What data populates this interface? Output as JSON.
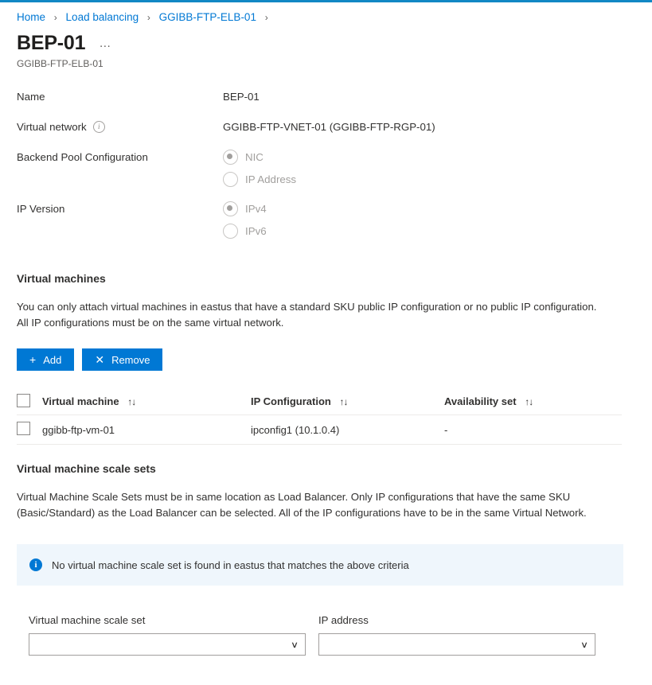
{
  "theme": {
    "accent": "#0078d4",
    "top_bar": "#1288c4",
    "banner_bg": "#eff6fc",
    "link": "#0078d4",
    "text": "#323130",
    "muted": "#605e5c",
    "disabled": "#a19f9d"
  },
  "breadcrumb": {
    "items": [
      "Home",
      "Load balancing",
      "GGIBB-FTP-ELB-01"
    ],
    "separator": "›",
    "trailing_separator": "›"
  },
  "header": {
    "title": "BEP-01",
    "subtitle": "GGIBB-FTP-ELB-01",
    "more_menu": "…"
  },
  "properties": [
    {
      "label": "Name",
      "value": "BEP-01",
      "has_info": false,
      "type": "text"
    },
    {
      "label": "Virtual network",
      "value": "GGIBB-FTP-VNET-01 (GGIBB-FTP-RGP-01)",
      "has_info": true,
      "info_glyph": "i",
      "type": "text"
    },
    {
      "label": "Backend Pool Configuration",
      "type": "radio",
      "options": [
        {
          "label": "NIC",
          "selected": true
        },
        {
          "label": "IP Address",
          "selected": false
        }
      ]
    },
    {
      "label": "IP Version",
      "type": "radio",
      "options": [
        {
          "label": "IPv4",
          "selected": true
        },
        {
          "label": "IPv6",
          "selected": false
        }
      ]
    }
  ],
  "virtual_machines": {
    "heading": "Virtual machines",
    "description_line1": "You can only attach virtual machines in eastus that have a standard SKU public IP configuration or no public IP configuration.",
    "description_line2": "All IP configurations must be on the same virtual network.",
    "toolbar": {
      "add_label": "Add",
      "add_glyph": "+",
      "remove_label": "Remove",
      "remove_glyph": "✕"
    },
    "table": {
      "sort_glyph": "↑↓",
      "columns": [
        "Virtual machine",
        "IP Configuration",
        "Availability set"
      ],
      "rows": [
        {
          "checked": false,
          "virtual_machine": "ggibb-ftp-vm-01",
          "ip_configuration": "ipconfig1 (10.1.0.4)",
          "availability_set": "-"
        }
      ]
    }
  },
  "scale_sets": {
    "heading": "Virtual machine scale sets",
    "description_line1": "Virtual Machine Scale Sets must be in same location as Load Balancer. Only IP configurations that have the same SKU",
    "description_line2": "(Basic/Standard) as the Load Balancer can be selected. All of the IP configurations have to be in the same Virtual Network.",
    "banner": {
      "icon_glyph": "i",
      "message": "No virtual machine scale set is found in eastus that matches the above criteria"
    },
    "fields": [
      {
        "label": "Virtual machine scale set",
        "value": "",
        "caret": "∨"
      },
      {
        "label": "IP address",
        "value": "",
        "caret": "∨"
      }
    ]
  }
}
